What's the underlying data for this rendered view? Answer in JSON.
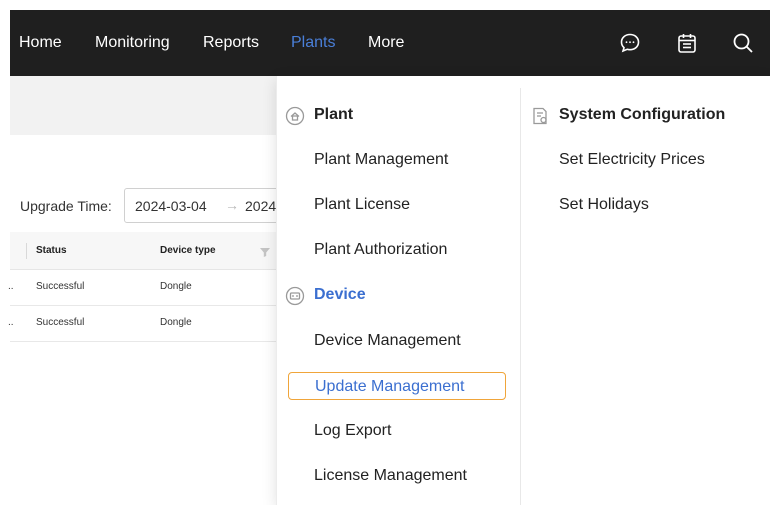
{
  "nav": {
    "items": [
      {
        "label": "Home"
      },
      {
        "label": "Monitoring"
      },
      {
        "label": "Reports"
      },
      {
        "label": "Plants",
        "active": true
      },
      {
        "label": "More"
      }
    ],
    "icons": [
      "chat-icon",
      "calendar-icon",
      "search-icon"
    ]
  },
  "filter": {
    "label": "Upgrade Time:",
    "start": "2024-03-04",
    "separator": "→",
    "end": "2024"
  },
  "table": {
    "headers": [
      "Status",
      "Device type"
    ],
    "rows": [
      {
        "status": "Successful",
        "device_type": "Dongle"
      },
      {
        "status": "Successful",
        "device_type": "Dongle"
      }
    ]
  },
  "menu": {
    "plant": {
      "title": "Plant",
      "items": [
        "Plant Management",
        "Plant License",
        "Plant Authorization"
      ]
    },
    "device": {
      "title": "Device",
      "items": [
        "Device Management",
        "Update Management",
        "Log Export",
        "License Management"
      ],
      "selected": "Update Management"
    },
    "system": {
      "title": "System Configuration",
      "items": [
        "Set Electricity Prices",
        "Set Holidays"
      ]
    }
  },
  "colors": {
    "nav_bg": "#1f1f1f",
    "active_nav": "#4a7fd8",
    "link_blue": "#3b6fd0",
    "highlight_border": "#f0a53a"
  }
}
